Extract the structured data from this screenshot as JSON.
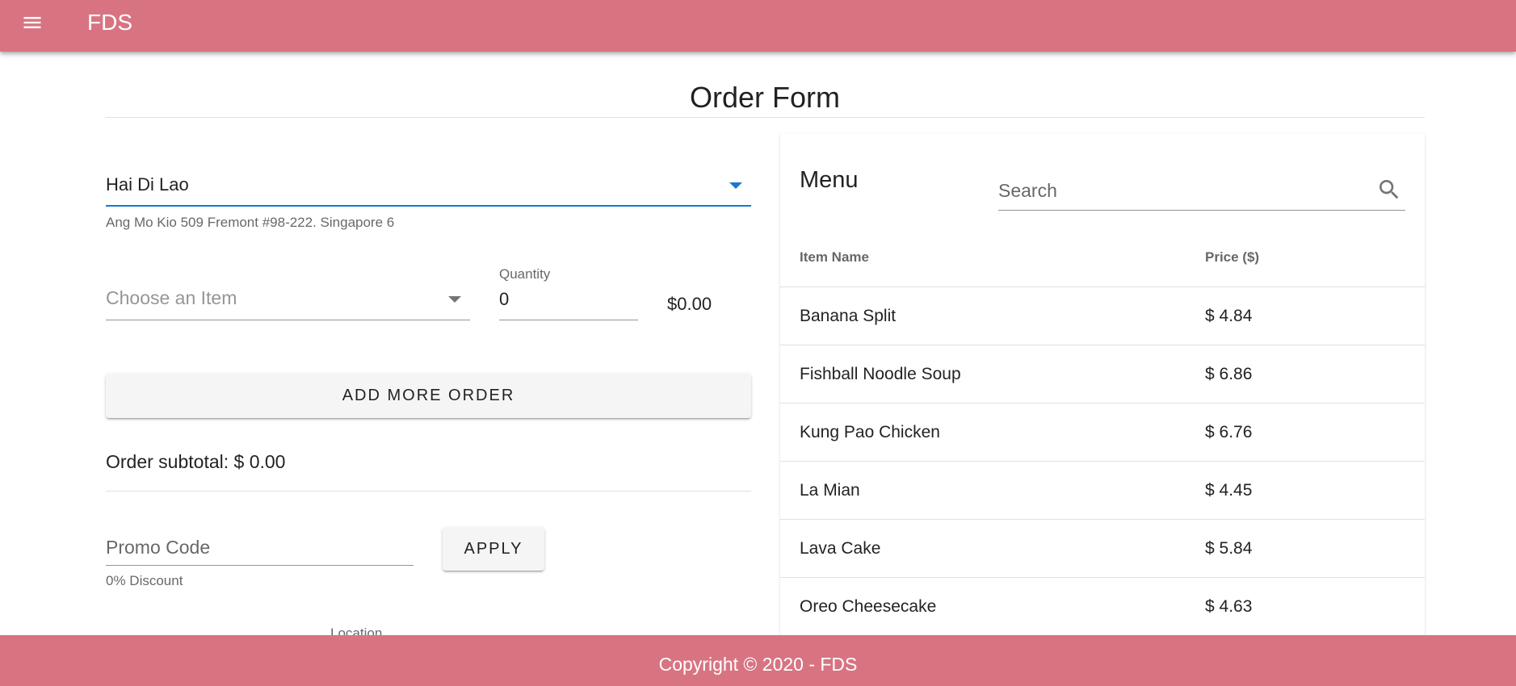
{
  "app": {
    "title": "FDS",
    "menu_icon": "menu-icon",
    "brand_color": "#d87482"
  },
  "page": {
    "title": "Order Form"
  },
  "order": {
    "restaurant": {
      "value": "Hai Di Lao",
      "address": "Ang Mo Kio 509 Fremont #98-222. Singapore 6"
    },
    "item": {
      "placeholder": "Choose an Item"
    },
    "quantity": {
      "label": "Quantity",
      "value": "0"
    },
    "line_price": "$0.00",
    "add_button_label": "ADD MORE ORDER",
    "subtotal": "Order subtotal: $ 0.00",
    "promo": {
      "placeholder": "Promo Code",
      "apply_label": "APPLY",
      "discount": "0% Discount"
    },
    "location_label": "Location"
  },
  "menu": {
    "title": "Menu",
    "search_placeholder": "Search",
    "columns": [
      "Item Name",
      "Price ($)"
    ],
    "rows": [
      {
        "name": "Banana Split",
        "price": "$ 4.84"
      },
      {
        "name": "Fishball Noodle Soup",
        "price": "$ 6.86"
      },
      {
        "name": "Kung Pao Chicken",
        "price": "$ 6.76"
      },
      {
        "name": "La Mian",
        "price": "$ 4.45"
      },
      {
        "name": "Lava Cake",
        "price": "$ 5.84"
      },
      {
        "name": "Oreo Cheesecake",
        "price": "$ 4.63"
      }
    ]
  },
  "footer": {
    "text": "Copyright © 2020 - FDS"
  }
}
